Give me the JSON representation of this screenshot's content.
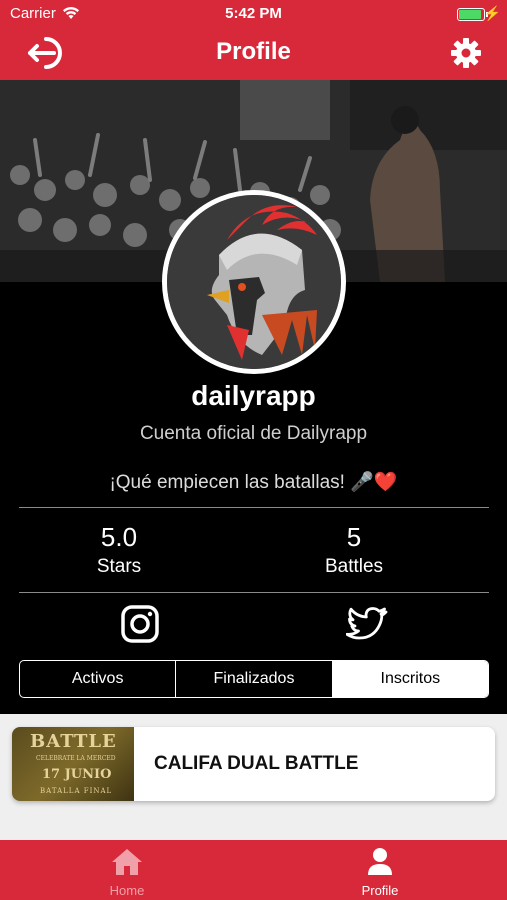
{
  "status_bar": {
    "carrier": "Carrier",
    "time": "5:42 PM",
    "battery_level": 0.95
  },
  "nav": {
    "title": "Profile",
    "left_icon": "logout-icon",
    "right_icon": "gear-icon"
  },
  "profile": {
    "username": "dailyrapp",
    "subtitle": "Cuenta oficial de Dailyrapp",
    "bio": "¡Qué empiecen las batallas! 🎤❤️"
  },
  "stats": [
    {
      "value": "5.0",
      "label": "Stars"
    },
    {
      "value": "5",
      "label": "Battles"
    }
  ],
  "social": [
    "instagram-icon",
    "twitter-icon"
  ],
  "tabs": [
    {
      "label": "Activos",
      "active": false
    },
    {
      "label": "Finalizados",
      "active": false
    },
    {
      "label": "Inscritos",
      "active": true
    }
  ],
  "battles": [
    {
      "title": "CALIFA DUAL BATTLE",
      "thumbnail_text": {
        "line1": "BATTLE",
        "line2": "CELEBRATE LA MERCED",
        "line3": "17 JUNIO",
        "line4": "BATALLA FINAL"
      }
    }
  ],
  "tab_bar": [
    {
      "label": "Home",
      "icon": "home-icon",
      "active": false
    },
    {
      "label": "Profile",
      "icon": "user-icon",
      "active": true
    }
  ],
  "colors": {
    "brand": "#d8293a",
    "background": "#000000",
    "list_background": "#efefef"
  }
}
